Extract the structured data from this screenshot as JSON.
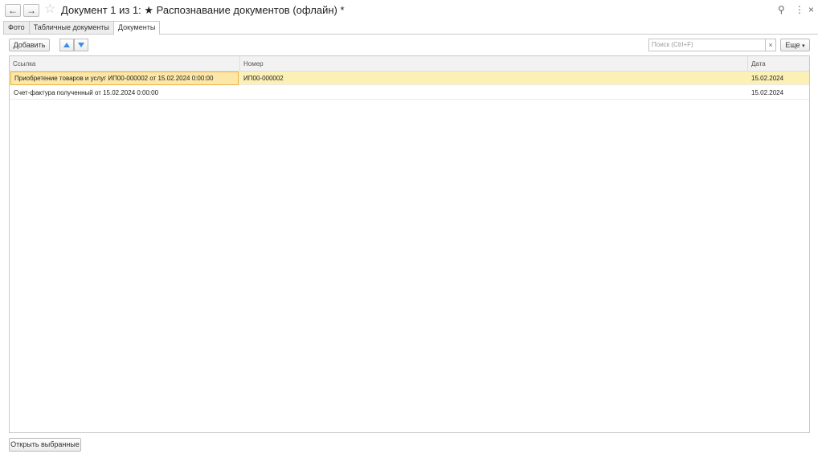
{
  "window": {
    "title": "Документ 1 из 1: ★ Распознавание документов (офлайн) *",
    "back_icon": "←",
    "forward_icon": "→",
    "star_icon": "☆",
    "link_icon": "⚲",
    "more_icon": "⋮",
    "close_icon": "×"
  },
  "tabs": [
    {
      "label": "Фото"
    },
    {
      "label": "Табличные документы"
    },
    {
      "label": "Документы"
    }
  ],
  "toolbar": {
    "add_label": "Добавить",
    "search_placeholder": "Поиск (Ctrl+F)",
    "clear_label": "×",
    "more_label": "Еще"
  },
  "table": {
    "columns": [
      "Ссылка",
      "Номер",
      "Дата"
    ],
    "rows": [
      {
        "ref": "Приобретение товаров и услуг ИП00-000002 от 15.02.2024 0:00:00",
        "number": "ИП00-000002",
        "date": "15.02.2024"
      },
      {
        "ref": "Счет-фактура полученный  от 15.02.2024 0:00:00",
        "number": "",
        "date": "15.02.2024"
      }
    ]
  },
  "footer": {
    "open_selected_label": "Открыть выбранные"
  }
}
